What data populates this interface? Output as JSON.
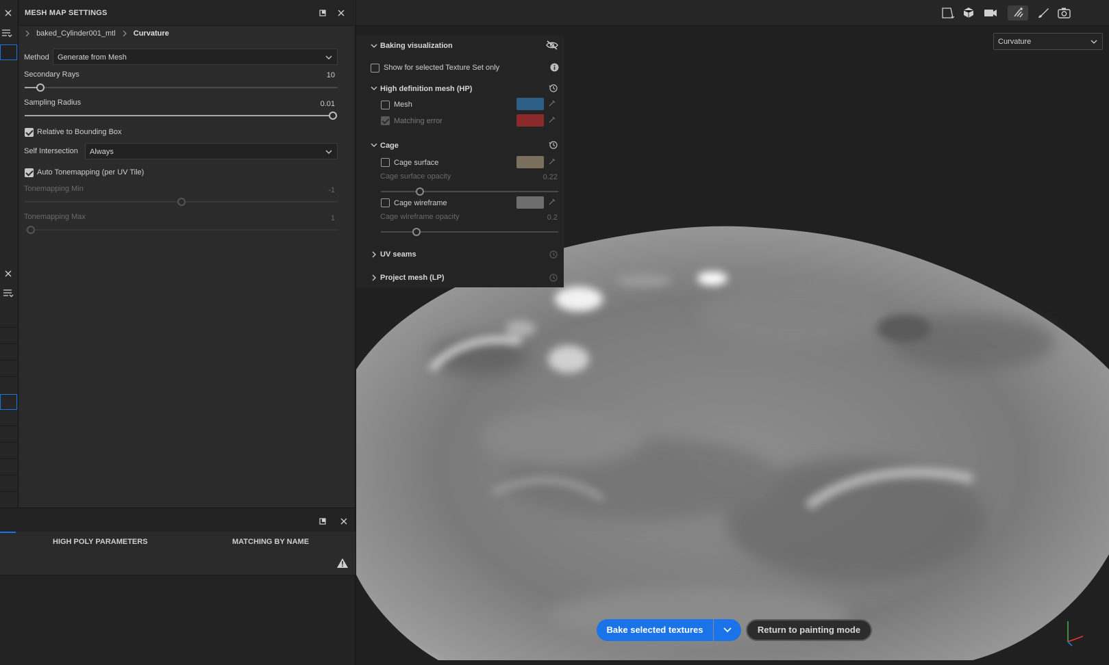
{
  "panel": {
    "title": "MESH MAP SETTINGS",
    "breadcrumb": {
      "parent": "baked_Cylinder001_mtl",
      "current": "Curvature"
    },
    "method": {
      "label": "Method",
      "value": "Generate from Mesh"
    },
    "secondary_rays": {
      "label": "Secondary Rays",
      "value": "10",
      "level": 0.05
    },
    "sampling_radius": {
      "label": "Sampling Radius",
      "value": "0.01",
      "level": 1.0
    },
    "relative_bbox": {
      "label": "Relative to Bounding Box",
      "checked": true
    },
    "self_intersection": {
      "label": "Self Intersection",
      "value": "Always"
    },
    "auto_tonemapping": {
      "label": "Auto Tonemapping (per UV Tile)",
      "checked": true
    },
    "tonemapping_min": {
      "label": "Tonemapping Min",
      "value": "-1",
      "level": 0.5
    },
    "tonemapping_max": {
      "label": "Tonemapping Max",
      "value": "1",
      "level": 0.02
    }
  },
  "bottom_panel": {
    "tabs": [
      {
        "label": "HIGH POLY PARAMETERS"
      },
      {
        "label": "MATCHING BY NAME"
      }
    ]
  },
  "viewport": {
    "display_select": "Curvature",
    "baking_visualization": {
      "title": "Baking visualization",
      "show_selected_only": "Show for selected Texture Set only",
      "hp_section": {
        "title": "High definition mesh (HP)",
        "mesh_label": "Mesh",
        "mesh_color": "#2d5f86",
        "matching_error_label": "Matching error",
        "matching_error_color": "#8a2a2a"
      },
      "cage_section": {
        "title": "Cage",
        "surface_label": "Cage surface",
        "surface_color": "#7a6e5d",
        "surface_opacity_label": "Cage surface opacity",
        "surface_opacity_value": "0.22",
        "surface_opacity_level": 0.22,
        "wireframe_label": "Cage wireframe",
        "wireframe_color": "#6e6e6e",
        "wireframe_opacity_label": "Cage wireframe opacity",
        "wireframe_opacity_value": "0.2",
        "wireframe_opacity_level": 0.2
      },
      "uv_seams": "UV seams",
      "project_mesh": "Project mesh (LP)"
    },
    "bake_button": "Bake selected textures",
    "return_button": "Return to painting mode",
    "accent": "#1a73e8"
  }
}
